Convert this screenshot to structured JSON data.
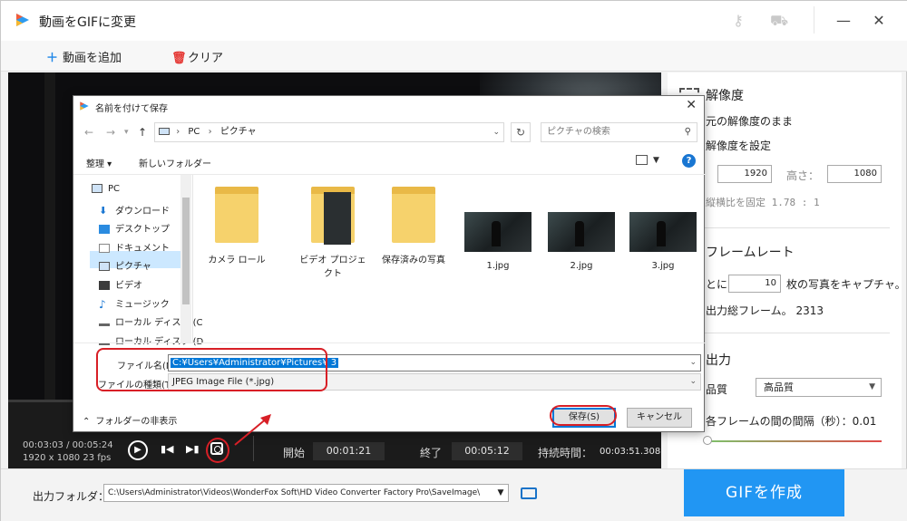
{
  "app": {
    "title": "動画をGIFに変更"
  },
  "toolbar": {
    "add_video": "動画を追加",
    "clear": "クリア"
  },
  "player": {
    "current_time": "00:03:03 / 00:05:24",
    "resolution_fps": "1920 x 1080   23 fps",
    "start_label": "開始",
    "start_value": "00:01:21",
    "end_label": "終了",
    "end_value": "00:05:12",
    "duration_label": "持続時間：",
    "duration_value": "00:03:51.308"
  },
  "settings": {
    "resolution_header": "解像度",
    "keep_original": "元の解像度のまま",
    "set_resolution": "解像度を設定",
    "width_value": "1920",
    "height_label": "高さ：",
    "height_value": "1080",
    "lock_ratio": "縦横比を固定  1.78 : 1",
    "framerate_header": "フレームレート",
    "capture_prefix": "とに",
    "capture_value": "10",
    "capture_suffix": "枚の写真をキャプチャ。",
    "total_frames": "出力総フレーム。  2313",
    "output_header": "出力",
    "quality_label": "品質",
    "quality_value": "高品質",
    "interval_label": "各フレームの間の間隔（秒）：0.01"
  },
  "bottom": {
    "output_folder_label": "出力フォルダ：",
    "output_folder_path": "C:\\Users\\Administrator\\Videos\\WonderFox Soft\\HD Video Converter Factory Pro\\SaveImage\\",
    "create_gif": "GIFを作成"
  },
  "dialog": {
    "title": "名前を付けて保存",
    "path_pc": "PC",
    "path_sep": "›",
    "path_folder": "ピクチャ",
    "search_placeholder": "ピクチャの検索",
    "organize": "整理 ▾",
    "new_folder": "新しいフォルダー",
    "help": "?",
    "tree": [
      {
        "label": "PC"
      },
      {
        "label": "ダウンロード"
      },
      {
        "label": "デスクトップ"
      },
      {
        "label": "ドキュメント"
      },
      {
        "label": "ピクチャ"
      },
      {
        "label": "ビデオ"
      },
      {
        "label": "ミュージック"
      },
      {
        "label": "ローカル ディスク (C"
      },
      {
        "label": "ローカル ディスク (D"
      }
    ],
    "files": [
      {
        "name": "カメラ ロール",
        "kind": "folder"
      },
      {
        "name": "ビデオ プロジェクト",
        "kind": "folder"
      },
      {
        "name": "保存済みの写真",
        "kind": "folder"
      },
      {
        "name": "1.jpg",
        "kind": "image"
      },
      {
        "name": "2.jpg",
        "kind": "image"
      },
      {
        "name": "3.jpg",
        "kind": "image"
      }
    ],
    "filename_label": "ファイル名(N):",
    "filename_value": "C:¥Users¥Administrator¥Pictures¥ 3",
    "filetype_label": "ファイルの種類(T):",
    "filetype_value": "JPEG Image File (*.jpg)",
    "hide_folders": "フォルダーの非表示",
    "save": "保存(S)",
    "cancel": "キャンセル"
  },
  "colors": {
    "accent": "#2196f3",
    "annotation": "#d81f26",
    "selection": "#0078d7"
  }
}
